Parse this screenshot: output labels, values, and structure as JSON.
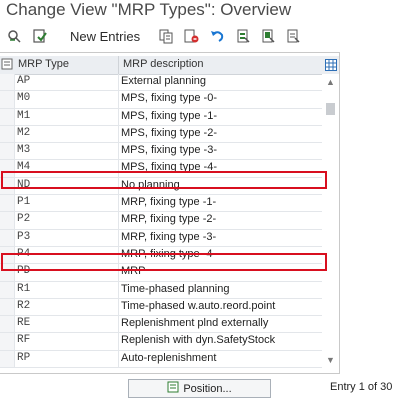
{
  "title": "Change View \"MRP Types\": Overview",
  "toolbar": {
    "new_entries": "New Entries",
    "icons": [
      "display-change-icon",
      "check-icon",
      "copy-icon",
      "delete-icon",
      "undo-icon",
      "select-all-icon",
      "select-block-icon",
      "deselect-all-icon"
    ]
  },
  "table": {
    "headers": {
      "type": "MRP Type",
      "desc": "MRP description"
    },
    "rows": [
      {
        "code": "AP",
        "desc": "External planning"
      },
      {
        "code": "M0",
        "desc": "MPS, fixing type -0-"
      },
      {
        "code": "M1",
        "desc": "MPS, fixing type -1-"
      },
      {
        "code": "M2",
        "desc": "MPS, fixing type -2-"
      },
      {
        "code": "M3",
        "desc": "MPS, fixing type  -3-"
      },
      {
        "code": "M4",
        "desc": "MPS, fixing type -4-"
      },
      {
        "code": "ND",
        "desc": "No planning"
      },
      {
        "code": "P1",
        "desc": "MRP, fixing type -1-"
      },
      {
        "code": "P2",
        "desc": "MRP, fixing type -2-"
      },
      {
        "code": "P3",
        "desc": "MRP, fixing type -3-"
      },
      {
        "code": "P4",
        "desc": "MRP, fixing type -4-"
      },
      {
        "code": "PD",
        "desc": "MRP"
      },
      {
        "code": "R1",
        "desc": "Time-phased planning"
      },
      {
        "code": "R2",
        "desc": "Time-phased w.auto.reord.point"
      },
      {
        "code": "RE",
        "desc": "Replenishment plnd externally"
      },
      {
        "code": "RF",
        "desc": "Replenish with dyn.SafetyStock"
      },
      {
        "code": "RP",
        "desc": "Auto-replenishment"
      }
    ],
    "highlighted_codes": [
      "ND",
      "PD"
    ]
  },
  "footer": {
    "position_label": "Position...",
    "entry_text": "Entry 1 of 30"
  },
  "colors": {
    "highlight": "#d80f1f"
  }
}
